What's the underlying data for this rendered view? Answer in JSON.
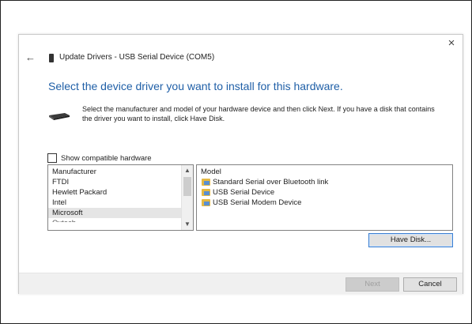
{
  "dialog": {
    "title": "Update Drivers - USB Serial Device (COM5)",
    "close_glyph": "×",
    "back_glyph": "←",
    "heading": "Select the device driver you want to install for this hardware.",
    "instructions": "Select the manufacturer and model of your hardware device and then click Next. If you have a disk that contains the driver you want to install, click Have Disk."
  },
  "compatible": {
    "label": "Show compatible hardware",
    "checked": false
  },
  "manufacturer_list": {
    "header": "Manufacturer",
    "items": [
      "FTDI",
      "Hewlett Packard",
      "Intel",
      "Microsoft",
      "Oxtech"
    ],
    "selected": "Microsoft"
  },
  "model_list": {
    "header": "Model",
    "items": [
      "Standard Serial over Bluetooth link",
      "USB Serial Device",
      "USB Serial Modem Device"
    ]
  },
  "buttons": {
    "have_disk": "Have Disk...",
    "next": "Next",
    "cancel": "Cancel"
  },
  "icons": {
    "back": "back-arrow-icon",
    "close": "close-icon",
    "title": "device-manager-icon",
    "device": "serial-device-icon",
    "driver": "driver-icon"
  },
  "colors": {
    "heading": "#1f5fa7",
    "selected_row": "#e5e5e5",
    "default_button_border": "#3c7fd1"
  }
}
